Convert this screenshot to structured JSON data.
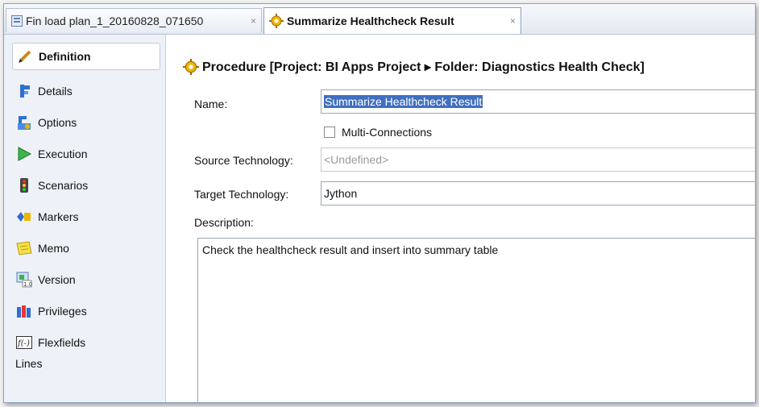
{
  "tabs": [
    {
      "label": "Fin load plan_1_20160828_071650",
      "close": "×",
      "icon": "load-plan-icon"
    },
    {
      "label": "Summarize Healthcheck Result",
      "close": "×",
      "icon": "procedure-gear-icon"
    }
  ],
  "sidebar": {
    "items": [
      {
        "label": "Definition",
        "icon": "pencil-icon"
      },
      {
        "label": "Details",
        "icon": "details-icon"
      },
      {
        "label": "Options",
        "icon": "options-icon"
      },
      {
        "label": "Execution",
        "icon": "play-icon"
      },
      {
        "label": "Scenarios",
        "icon": "traffic-light-icon"
      },
      {
        "label": "Markers",
        "icon": "markers-icon"
      },
      {
        "label": "Memo",
        "icon": "memo-icon"
      },
      {
        "label": "Version",
        "icon": "version-icon"
      },
      {
        "label": "Privileges",
        "icon": "privileges-icon"
      },
      {
        "label": "Flexfields",
        "icon": "flexfields-icon"
      }
    ],
    "lines_label": "Lines"
  },
  "main": {
    "heading": "Procedure [Project: BI Apps Project ▸ Folder: Diagnostics Health Check]",
    "name_label": "Name:",
    "name_value": "Summarize Healthcheck Result",
    "multi_connections_label": "Multi-Connections",
    "multi_connections_checked": false,
    "source_tech_label": "Source Technology:",
    "source_tech_value": "<Undefined>",
    "target_tech_label": "Target Technology:",
    "target_tech_value": "Jython",
    "description_label": "Description:",
    "description_value": "Check the healthcheck result and insert into summary table"
  },
  "colors": {
    "selection": "#3f6fc0",
    "sidebar_bg": "#eef2f8",
    "border": "#8aa2c4"
  }
}
